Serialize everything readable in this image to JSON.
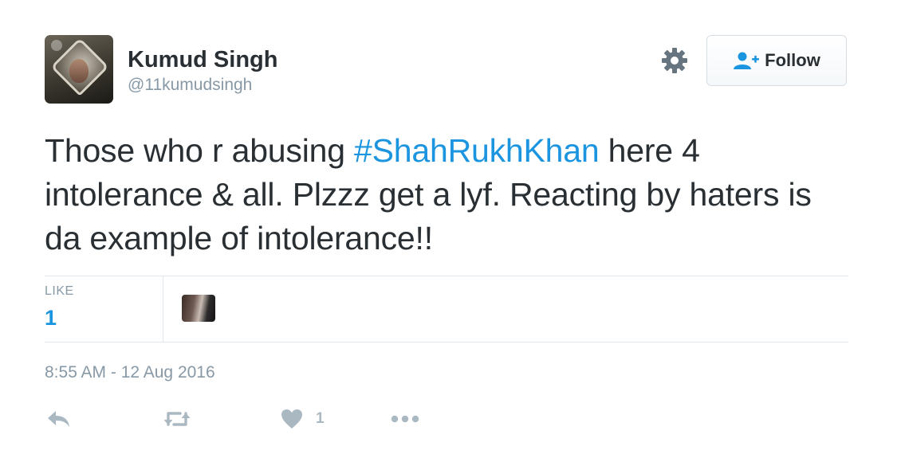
{
  "user": {
    "name": "Kumud Singh",
    "handle": "@11kumudsingh",
    "avatar_icon": "profile-photo"
  },
  "header": {
    "settings_icon": "gear-icon",
    "follow_label": "Follow",
    "follow_icon": "add-user-icon"
  },
  "tweet": {
    "text_before": "Those who r abusing ",
    "hashtag": "#ShahRukhKhan",
    "text_after": " here 4 intolerance & all. Plzzz get a lyf. Reacting by haters is da example of intolerance!!"
  },
  "stats": {
    "like_label": "LIKE",
    "like_count": "1"
  },
  "meta": {
    "timestamp": "8:55 AM - 12 Aug 2016"
  },
  "actions": {
    "reply_icon": "reply-icon",
    "retweet_icon": "retweet-icon",
    "like_icon": "heart-icon",
    "like_count": "1",
    "more_icon": "more-icon"
  },
  "colors": {
    "accent": "#1b95e0",
    "text": "#292f33",
    "muted": "#8899a6",
    "icon": "#aab8c2",
    "border": "#e1e8ed"
  }
}
